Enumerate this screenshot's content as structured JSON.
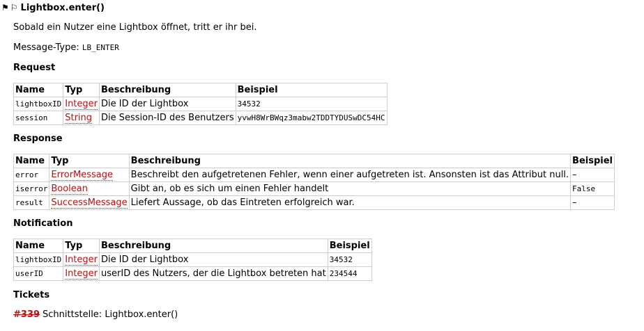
{
  "header": {
    "title": "Lightbox.enter()"
  },
  "description": "Sobald ein Nutzer eine Lightbox öffnet, tritt er ihr bei.",
  "message_type": {
    "label": "Message-Type:",
    "value": "LB_ENTER"
  },
  "request": {
    "heading": "Request",
    "columns": [
      "Name",
      "Typ",
      "Beschreibung",
      "Beispiel"
    ],
    "rows": [
      {
        "name": "lightboxID",
        "type": "Integer",
        "desc": "Die ID der Lightbox",
        "example": "34532"
      },
      {
        "name": "session",
        "type": "String",
        "desc": "Die Session-ID des Benutzers",
        "example": "yvwH8WrBWqz3mabw2TDDTYDUSwDC54HC"
      }
    ]
  },
  "response": {
    "heading": "Response",
    "columns": [
      "Name",
      "Typ",
      "Beschreibung",
      "Beispiel"
    ],
    "rows": [
      {
        "name": "error",
        "type": "ErrorMessage",
        "desc": "Beschreibt den aufgetretenen Fehler, wenn einer aufgetreten ist. Ansonsten ist das Attribut null.",
        "example": "–"
      },
      {
        "name": "iserror",
        "type": "Boolean",
        "desc": "Gibt an, ob es sich um einen Fehler handelt",
        "example": "False"
      },
      {
        "name": "result",
        "type": "SuccessMessage",
        "desc": "Liefert Aussage, ob das Eintreten erfolgreich war.",
        "example": "–"
      }
    ]
  },
  "notification": {
    "heading": "Notification",
    "columns": [
      "Name",
      "Typ",
      "Beschreibung",
      "Beispiel"
    ],
    "rows": [
      {
        "name": "lightboxID",
        "type": "Integer",
        "desc": "Die ID der Lightbox",
        "example": "34532"
      },
      {
        "name": "userID",
        "type": "Integer",
        "desc": "userID des Nutzers, der die Lightbox betreten hat",
        "example": "234544"
      }
    ]
  },
  "tickets": {
    "heading": "Tickets",
    "items": [
      {
        "number": "#339",
        "title": "Schnittstelle: Lightbox.enter()"
      }
    ]
  },
  "colors": {
    "type_link": "#bb1111",
    "table_border": "#cfcfcf"
  },
  "icons": [
    "flag-filled-icon",
    "flag-outline-icon"
  ]
}
